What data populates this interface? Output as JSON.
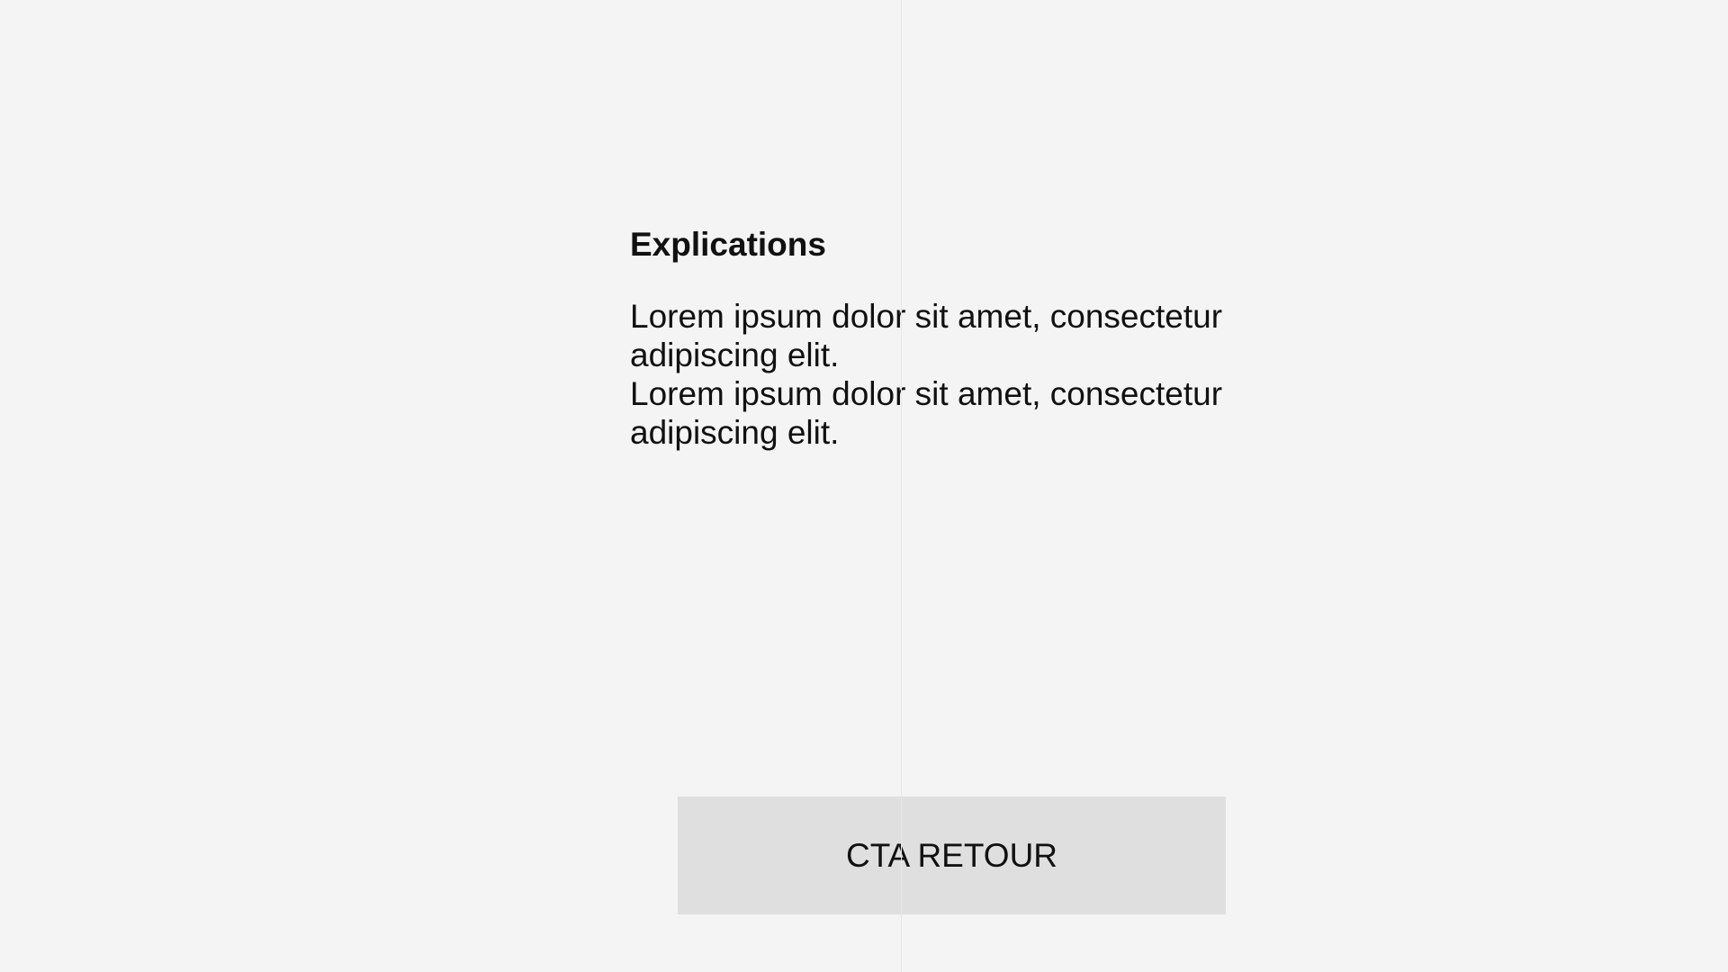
{
  "explanation": {
    "title": "Explications",
    "paragraphs": [
      "Lorem ipsum dolor sit amet, consectetur adipiscing elit.",
      "Lorem ipsum dolor sit amet, consectetur adipiscing elit."
    ]
  },
  "cta": {
    "label": "CTA RETOUR"
  },
  "colors": {
    "background": "#f4f4f4",
    "button": "#dfdfdf",
    "text": "#111111",
    "guide": "#e6e6e6"
  }
}
